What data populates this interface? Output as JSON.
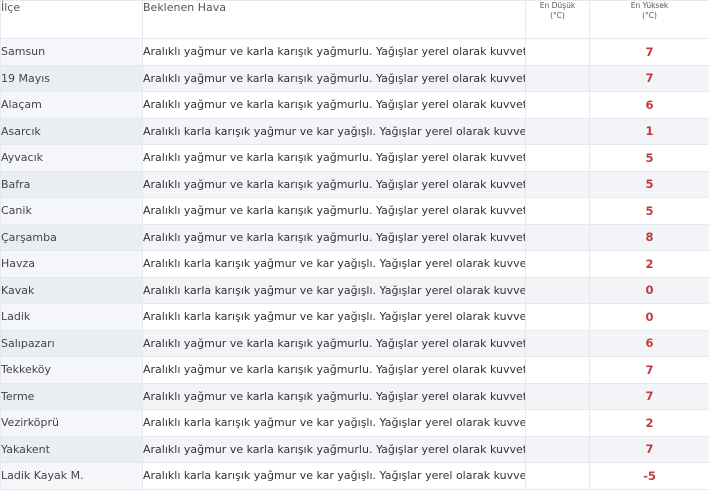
{
  "table": {
    "headers": {
      "district": "İlçe",
      "weather": "Beklenen Hava",
      "min_line1": "En Düşük",
      "min_line2": "(°C)",
      "max_line1": "En Yüksek",
      "max_line2": "(°C)"
    },
    "rows": [
      {
        "district": "Samsun",
        "weather": "Aralıklı yağmur ve karla karışık yağmurlu. Yağışlar yerel olarak kuvvetli.",
        "min": "",
        "max": "7"
      },
      {
        "district": "19 Mayıs",
        "weather": "Aralıklı yağmur ve karla karışık yağmurlu. Yağışlar yerel olarak kuvvetli.",
        "min": "",
        "max": "7"
      },
      {
        "district": "Alaçam",
        "weather": "Aralıklı yağmur ve karla karışık yağmurlu. Yağışlar yerel olarak kuvvetli.",
        "min": "",
        "max": "6"
      },
      {
        "district": "Asarcık",
        "weather": "Aralıklı karla karışık yağmur ve kar yağışlı. Yağışlar yerel olarak kuvvetli.",
        "min": "",
        "max": "1"
      },
      {
        "district": "Ayvacık",
        "weather": "Aralıklı yağmur ve karla karışık yağmurlu. Yağışlar yerel olarak kuvvetli.",
        "min": "",
        "max": "5"
      },
      {
        "district": "Bafra",
        "weather": "Aralıklı yağmur ve karla karışık yağmurlu. Yağışlar yerel olarak kuvvetli.",
        "min": "",
        "max": "5"
      },
      {
        "district": "Canik",
        "weather": "Aralıklı yağmur ve karla karışık yağmurlu. Yağışlar yerel olarak kuvvetli.",
        "min": "",
        "max": "5"
      },
      {
        "district": "Çarşamba",
        "weather": "Aralıklı yağmur ve karla karışık yağmurlu. Yağışlar yerel olarak kuvvetli.",
        "min": "",
        "max": "8"
      },
      {
        "district": "Havza",
        "weather": "Aralıklı karla karışık yağmur ve kar yağışlı. Yağışlar yerel olarak kuvvetli.",
        "min": "",
        "max": "2"
      },
      {
        "district": "Kavak",
        "weather": "Aralıklı karla karışık yağmur ve kar yağışlı. Yağışlar yerel olarak kuvvetli.",
        "min": "",
        "max": "0"
      },
      {
        "district": "Ladik",
        "weather": "Aralıklı karla karışık yağmur ve kar yağışlı. Yağışlar yerel olarak kuvvetli.",
        "min": "",
        "max": "0"
      },
      {
        "district": "Salıpazarı",
        "weather": "Aralıklı yağmur ve karla karışık yağmurlu. Yağışlar yerel olarak kuvvetli.",
        "min": "",
        "max": "6"
      },
      {
        "district": "Tekkeköy",
        "weather": "Aralıklı yağmur ve karla karışık yağmurlu. Yağışlar yerel olarak kuvvetli.",
        "min": "",
        "max": "7"
      },
      {
        "district": "Terme",
        "weather": "Aralıklı yağmur ve karla karışık yağmurlu. Yağışlar yerel olarak kuvvetli.",
        "min": "",
        "max": "7"
      },
      {
        "district": "Vezirköprü",
        "weather": "Aralıklı karla karışık yağmur ve kar yağışlı. Yağışlar yerel olarak kuvvetli.",
        "min": "",
        "max": "2"
      },
      {
        "district": "Yakakent",
        "weather": "Aralıklı yağmur ve karla karışık yağmurlu. Yağışlar yerel olarak kuvvetli.",
        "min": "",
        "max": "7"
      },
      {
        "district": "Ladik Kayak M.",
        "weather": "Aralıklı karla karışık yağmur ve kar yağışlı. Yağışlar yerel olarak kuvvetli.",
        "min": "",
        "max": "-5"
      }
    ]
  },
  "colors": {
    "max_temp": "#c23b3b",
    "district_bg": "#eaeef3",
    "border": "#e6eaef"
  }
}
